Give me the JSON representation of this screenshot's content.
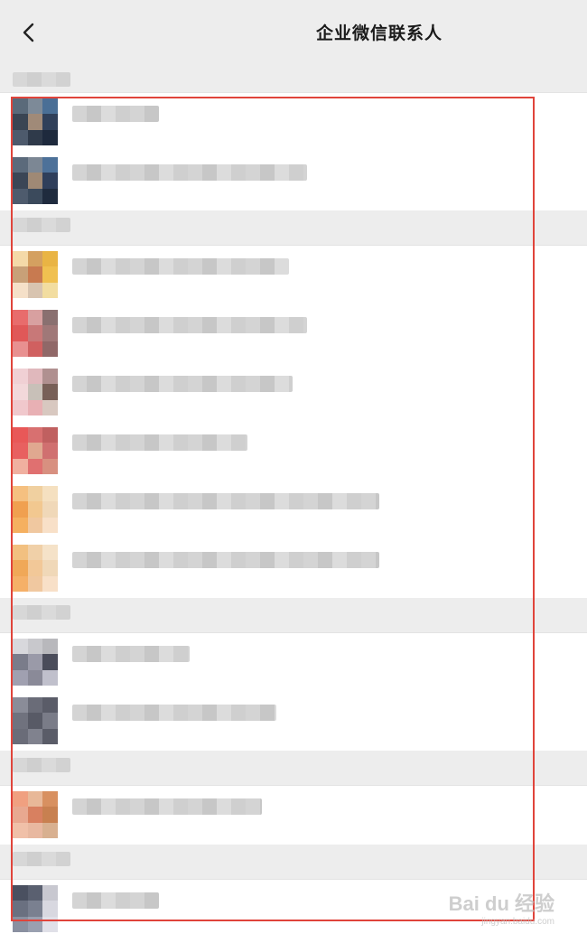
{
  "header": {
    "title": "企业微信联系人",
    "back_icon": "chevron-left-icon"
  },
  "colors": {
    "selection_border": "#e0443b",
    "header_bg": "#ededed",
    "group_bg": "#ededed"
  },
  "watermark": {
    "text": "Bai du 经验",
    "sub": "jingyan.baidu.com"
  },
  "list": [
    {
      "type": "group"
    },
    {
      "type": "row",
      "avatar": [
        "#5a6a7a",
        "#7d8a98",
        "#4a6f96",
        "#3a4553",
        "#a08a78",
        "#30405a",
        "#4d5a6c",
        "#2f3a4a",
        "#1e2a3d"
      ],
      "name_w": 96,
      "sub_w": 0
    },
    {
      "type": "row",
      "avatar": [
        "#5b6a7b",
        "#7c8794",
        "#4d7199",
        "#3b4656",
        "#9f8975",
        "#2f3f5b",
        "#4e5b6d",
        "#3b4a5c",
        "#1f2b3e"
      ],
      "name_w": 260,
      "sub_w": 0
    },
    {
      "type": "group"
    },
    {
      "type": "row",
      "avatar": [
        "#f4d9a8",
        "#d4a060",
        "#e9b444",
        "#c8a078",
        "#c87a50",
        "#f0c050",
        "#f5e0c8",
        "#d8c4b0",
        "#f2dda0"
      ],
      "name_w": 240,
      "sub_w": 0
    },
    {
      "type": "row",
      "avatar": [
        "#e86c6c",
        "#d8a0a0",
        "#8a7070",
        "#e05858",
        "#c87878",
        "#a07878",
        "#e89090",
        "#d06060",
        "#906868"
      ],
      "name_w": 260,
      "sub_w": 0
    },
    {
      "type": "row",
      "avatar": [
        "#f0d0d4",
        "#e0b8bc",
        "#b09090",
        "#f2d8da",
        "#c8c0b8",
        "#786058",
        "#f0c8cc",
        "#e8b0b4",
        "#d8c8c0"
      ],
      "name_w": 244,
      "sub_w": 0
    },
    {
      "type": "row",
      "avatar": [
        "#e85858",
        "#d87070",
        "#c06060",
        "#e86060",
        "#e0a890",
        "#d07070",
        "#f0b0a0",
        "#e07070",
        "#d89080"
      ],
      "name_w": 194,
      "sub_w": 0
    },
    {
      "type": "row",
      "avatar": [
        "#f5c080",
        "#f0d0a0",
        "#f5e0c0",
        "#f0a050",
        "#f2c890",
        "#f0d8b8",
        "#f5b060",
        "#f0c8a0",
        "#f8e0c8"
      ],
      "name_w": 340,
      "sub_w": 0
    },
    {
      "type": "row",
      "avatar": [
        "#f2c080",
        "#f0d0a8",
        "#f5e2c8",
        "#f0a858",
        "#f2c898",
        "#f0d8b8",
        "#f5b068",
        "#f0c8a0",
        "#f8e0c8"
      ],
      "name_w": 340,
      "sub_w": 0
    },
    {
      "type": "group"
    },
    {
      "type": "row",
      "avatar": [
        "#d8d8dc",
        "#c8c8cc",
        "#b8b8bc",
        "#7a7c8a",
        "#9a9aa8",
        "#4a4c5a",
        "#a0a0b0",
        "#8a8a98",
        "#c0c0cc"
      ],
      "name_w": 130,
      "sub_w": 0
    },
    {
      "type": "row",
      "avatar": [
        "#8a8c98",
        "#6a6c78",
        "#5a5c68",
        "#70727e",
        "#585a66",
        "#7a7c88",
        "#6a6c78",
        "#80828e",
        "#5a5c68"
      ],
      "name_w": 226,
      "sub_w": 0
    },
    {
      "type": "group"
    },
    {
      "type": "row",
      "avatar": [
        "#f0a080",
        "#e8b898",
        "#d89060",
        "#e8a890",
        "#d88060",
        "#c88050",
        "#f0c0a8",
        "#e8b8a0",
        "#d8b090"
      ],
      "name_w": 210,
      "sub_w": 0
    },
    {
      "type": "group"
    },
    {
      "type": "row",
      "avatar": [
        "#4a5060",
        "#5a6070",
        "#c8c8d0",
        "#6a7080",
        "#7a8090",
        "#d8d8e0",
        "#8a90a0",
        "#9aa0b0",
        "#e0e0e8"
      ],
      "name_w": 96,
      "sub_w": 0
    }
  ]
}
